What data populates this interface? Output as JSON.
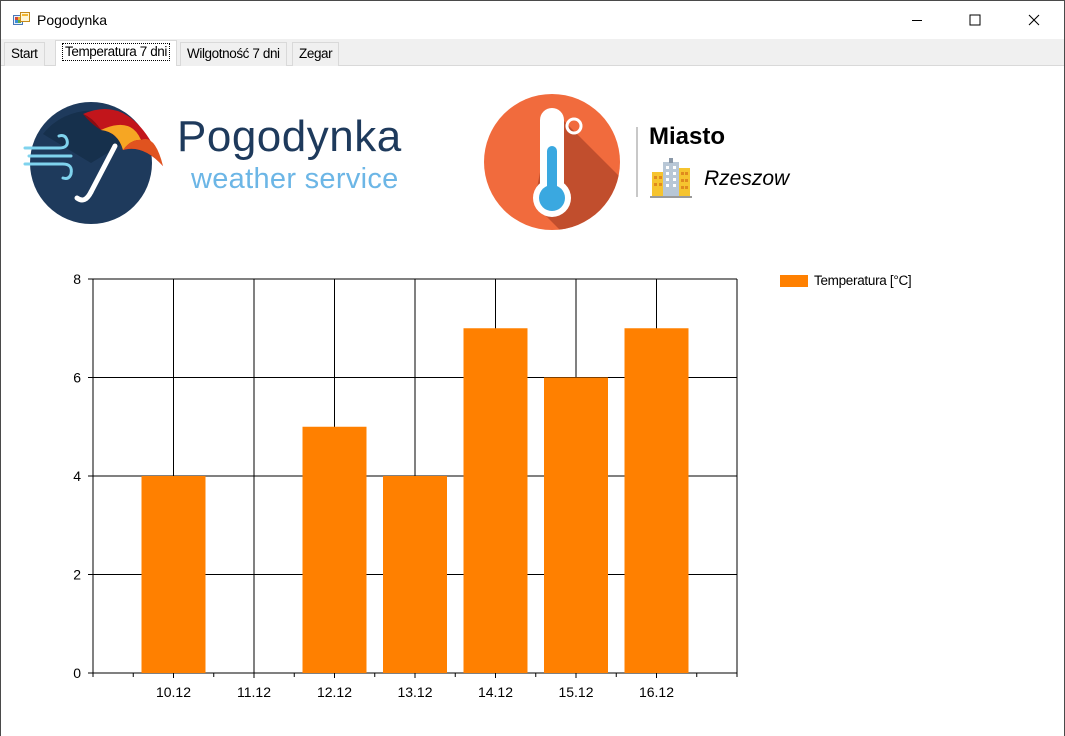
{
  "window": {
    "title": "Pogodynka",
    "controls": {
      "minimize_icon": "minimize-icon",
      "maximize_icon": "maximize-icon",
      "close_icon": "close-icon"
    }
  },
  "tabs": [
    {
      "label": "Start",
      "active": false
    },
    {
      "label": "Temperatura 7 dni",
      "active": true
    },
    {
      "label": "Wilgotność 7 dni",
      "active": false
    },
    {
      "label": "Zegar",
      "active": false
    }
  ],
  "header": {
    "logo_title": "Pogodynka",
    "logo_subtitle": "weather service",
    "city_label": "Miasto",
    "city_name": "Rzeszow"
  },
  "colors": {
    "accent": "#ff8000",
    "logo_dark": "#1e3a5c",
    "logo_light": "#6cb6e6",
    "thermo_bg": "#f16b3d"
  },
  "chart_data": {
    "type": "bar",
    "categories": [
      "10.12",
      "11.12",
      "12.12",
      "13.12",
      "14.12",
      "15.12",
      "16.12"
    ],
    "series": [
      {
        "name": "Temperatura [°C]",
        "values": [
          4,
          0,
          5,
          4,
          7,
          6,
          7
        ],
        "color": "#ff8000"
      }
    ],
    "ylim": [
      0,
      8
    ],
    "yticks": [
      0,
      2,
      4,
      6,
      8
    ],
    "grid": true,
    "legend_position": "top-right"
  }
}
